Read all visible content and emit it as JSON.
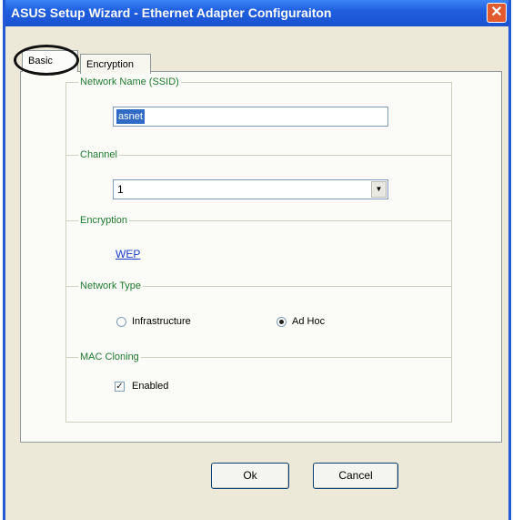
{
  "window": {
    "title": "ASUS Setup Wizard - Ethernet Adapter Configuraiton",
    "close_glyph": "✕"
  },
  "tabs": [
    {
      "label": "Basic",
      "selected": true
    },
    {
      "label": "Encryption",
      "selected": false
    }
  ],
  "network_name": {
    "label": "Network Name (SSID)",
    "value": "asnet"
  },
  "channel": {
    "label": "Channel",
    "value": "1",
    "arrow_glyph": "▼"
  },
  "encryption": {
    "label": "Encryption",
    "link_text": "WEP"
  },
  "network_type": {
    "label": "Network Type",
    "options": [
      {
        "label": "Infrastructure",
        "selected": false
      },
      {
        "label": "Ad Hoc",
        "selected": true
      }
    ]
  },
  "mac_cloning": {
    "label": "MAC Cloning",
    "checkbox_label": "Enabled",
    "checked": true,
    "check_glyph": "✓"
  },
  "buttons": {
    "ok": "Ok",
    "cancel": "Cancel"
  },
  "colors": {
    "title_bar": "#1f5fe0",
    "section_label": "#1e7a2e",
    "link": "#1a3ccc",
    "selection": "#316ac5"
  }
}
